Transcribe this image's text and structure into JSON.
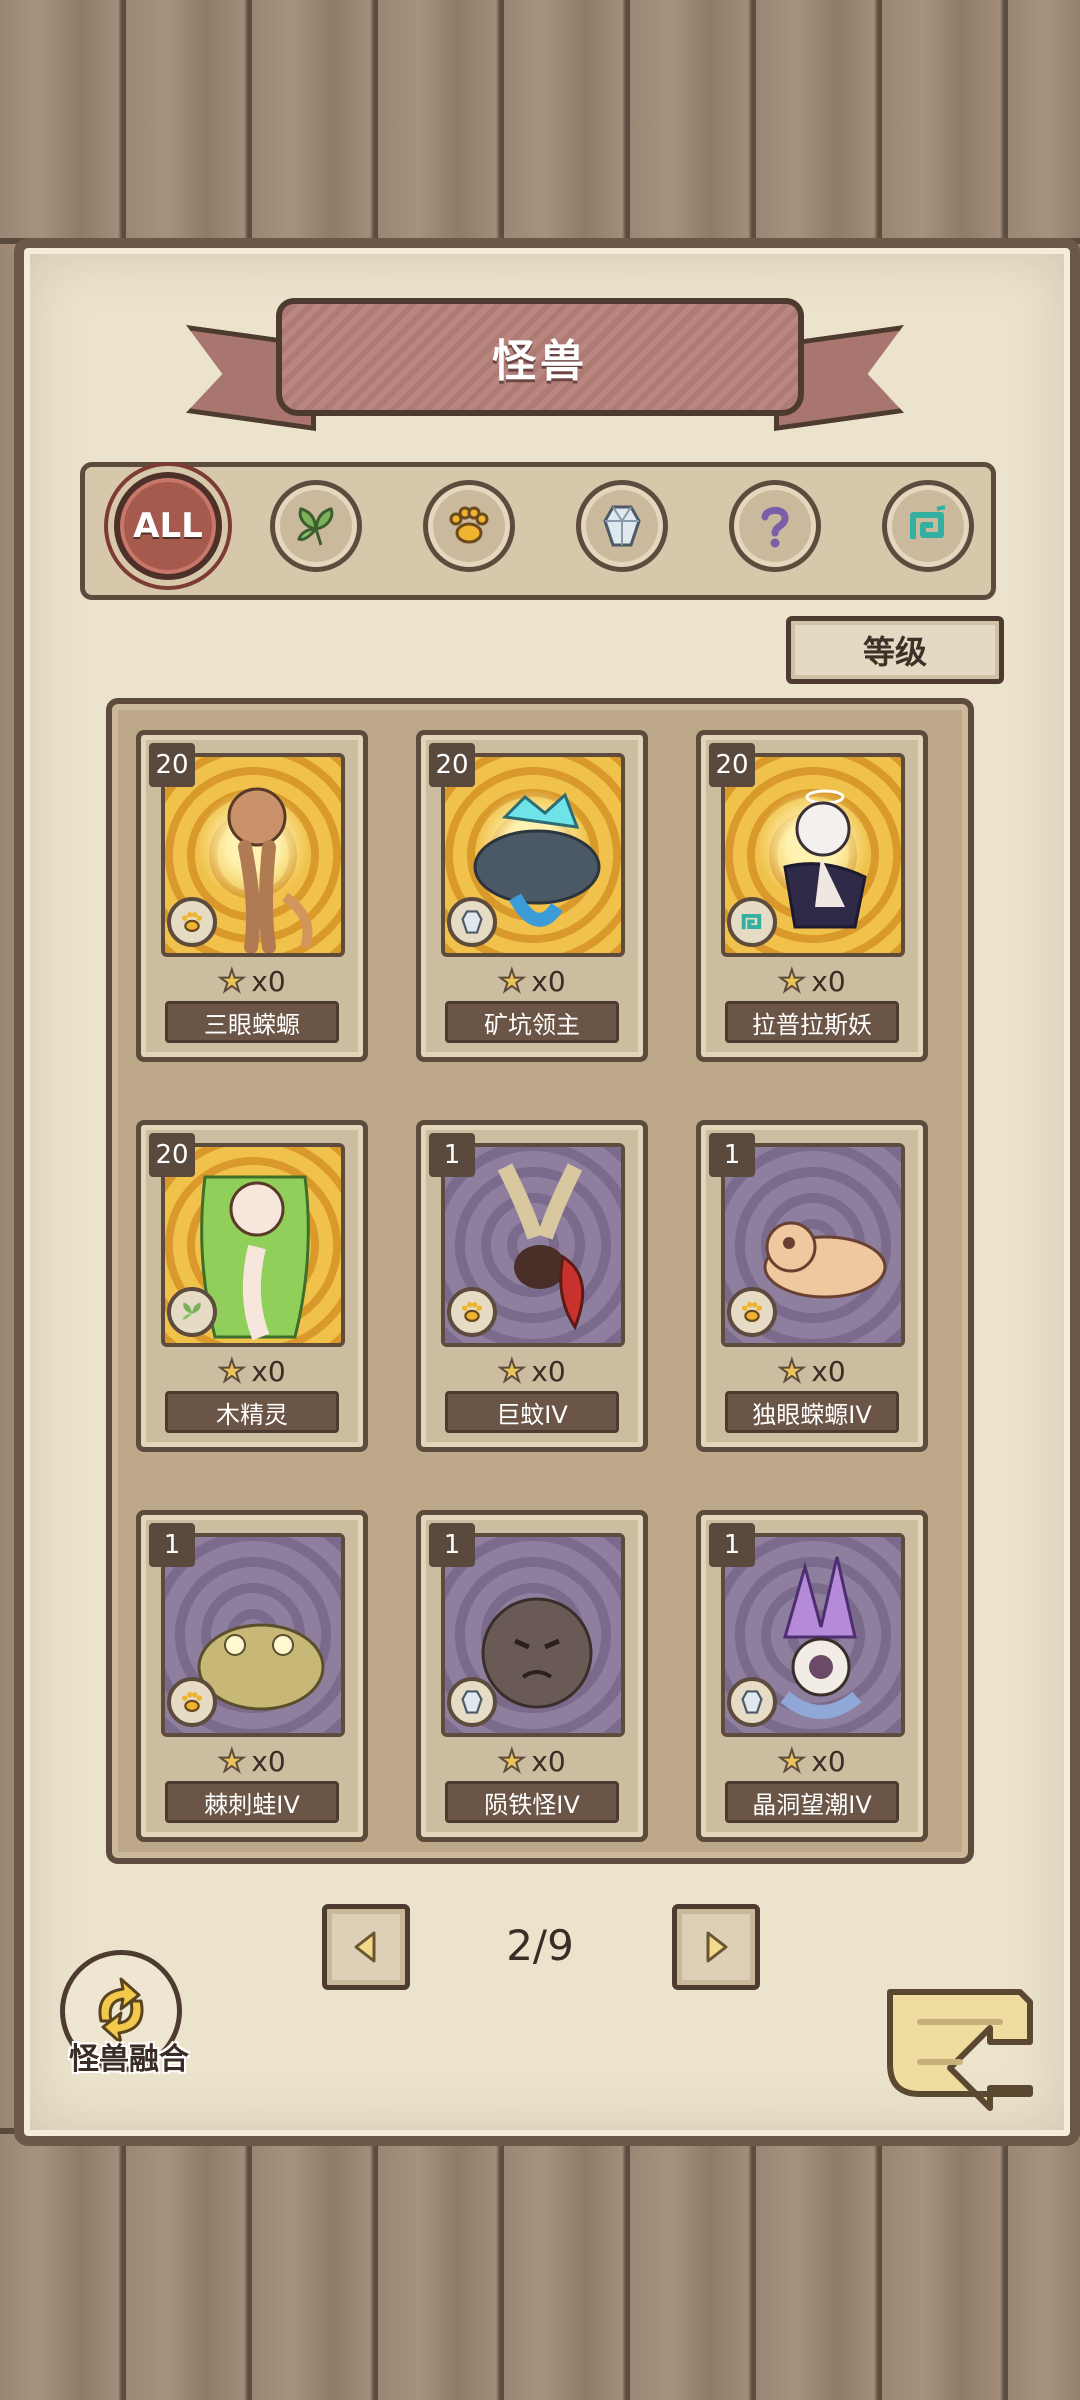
{
  "header": {
    "title": "怪兽"
  },
  "filters": [
    {
      "id": "all",
      "label": "ALL",
      "icon": "all-icon",
      "active": true
    },
    {
      "id": "plant",
      "icon": "leaf-icon",
      "active": false
    },
    {
      "id": "beast",
      "icon": "paw-icon",
      "active": false
    },
    {
      "id": "mineral",
      "icon": "crystal-icon",
      "active": false
    },
    {
      "id": "unknown",
      "icon": "question-icon",
      "active": false
    },
    {
      "id": "mystic",
      "icon": "spiral-icon",
      "active": false
    }
  ],
  "sort": {
    "label": "等级"
  },
  "cards": [
    {
      "level": "20",
      "count": "x0",
      "name": "三眼蝾螈",
      "type_icon": "paw-icon",
      "bg": "gold"
    },
    {
      "level": "20",
      "count": "x0",
      "name": "矿坑领主",
      "type_icon": "crystal-icon",
      "bg": "gold"
    },
    {
      "level": "20",
      "count": "x0",
      "name": "拉普拉斯妖",
      "type_icon": "spiral-icon",
      "bg": "gold"
    },
    {
      "level": "20",
      "count": "x0",
      "name": "木精灵",
      "type_icon": "leaf-icon",
      "bg": "gold"
    },
    {
      "level": "1",
      "count": "x0",
      "name": "巨蚊IV",
      "type_icon": "paw-icon",
      "bg": "purple"
    },
    {
      "level": "1",
      "count": "x0",
      "name": "独眼蝾螈IV",
      "type_icon": "paw-icon",
      "bg": "purple"
    },
    {
      "level": "1",
      "count": "x0",
      "name": "棘刺蛙IV",
      "type_icon": "paw-icon",
      "bg": "purple"
    },
    {
      "level": "1",
      "count": "x0",
      "name": "陨铁怪IV",
      "type_icon": "crystal-icon",
      "bg": "purple"
    },
    {
      "level": "1",
      "count": "x0",
      "name": "晶洞望潮IV",
      "type_icon": "crystal-icon",
      "bg": "purple"
    }
  ],
  "pagination": {
    "label": "2/9"
  },
  "fusion": {
    "label": "怪兽融合"
  }
}
